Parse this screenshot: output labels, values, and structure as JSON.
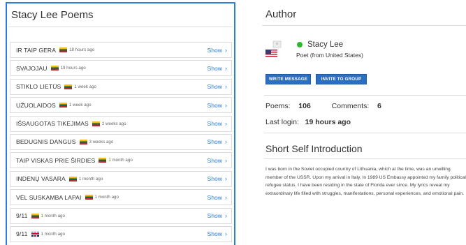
{
  "poems_panel": {
    "title": "Stacy Lee Poems",
    "show_label": "Show",
    "items": [
      {
        "title": "IR TAIP GERA",
        "flag": "lt",
        "time": "18 hours ago"
      },
      {
        "title": "SVAJOJAU",
        "flag": "lt",
        "time": "19 hours ago"
      },
      {
        "title": "STIKLO LIETŪS",
        "flag": "lt",
        "time": "1 week ago"
      },
      {
        "title": "UŽUOLAIDOS",
        "flag": "lt",
        "time": "1 week ago"
      },
      {
        "title": "IŠSAUGOTAS TIKĖJIMAS",
        "flag": "lt",
        "time": "2 weeks ago"
      },
      {
        "title": "BEDUGNIS DANGUS",
        "flag": "lt",
        "time": "3 weeks ago"
      },
      {
        "title": "TAIP VISKAS PRIE ŠIRDIES",
        "flag": "lt",
        "time": "1 month ago"
      },
      {
        "title": "INDĖNŲ VASARA",
        "flag": "lt",
        "time": "1 month ago"
      },
      {
        "title": "VĖL SUSKAMBA LAPAI",
        "flag": "lt",
        "time": "1 month ago"
      },
      {
        "title": "9/11",
        "flag": "lt",
        "time": "1 month ago"
      },
      {
        "title": "9/11",
        "flag": "uk",
        "time": "1 month ago"
      }
    ]
  },
  "author": {
    "heading": "Author",
    "name": "Stacy Lee",
    "subtitle": "Poet (from United States)",
    "write_message_label": "WRITE MESSAGE",
    "invite_label": "INVITE TO GROUP",
    "poems_label": "Poems:",
    "poems_count": "106",
    "comments_label": "Comments:",
    "comments_count": "6",
    "last_login_label": "Last login:",
    "last_login_value": "19 hours ago",
    "online_color": "#2db82d"
  },
  "intro": {
    "heading": "Short Self Introduction",
    "text": "I was born in the Soviet occupied country of Lithuania, which at the time, was an unwilling member of the USSR. Upon my arrival in Italy, In 1989 US Embassy appointed my family political refugee status. I have been residing in the state of Florida ever since. My lyrics reveal my extraordinary life filled with struggles, manifestations, personal experiences, and emotional pain."
  },
  "colors": {
    "accent": "#2a7de1",
    "button": "#2a6fc4"
  }
}
